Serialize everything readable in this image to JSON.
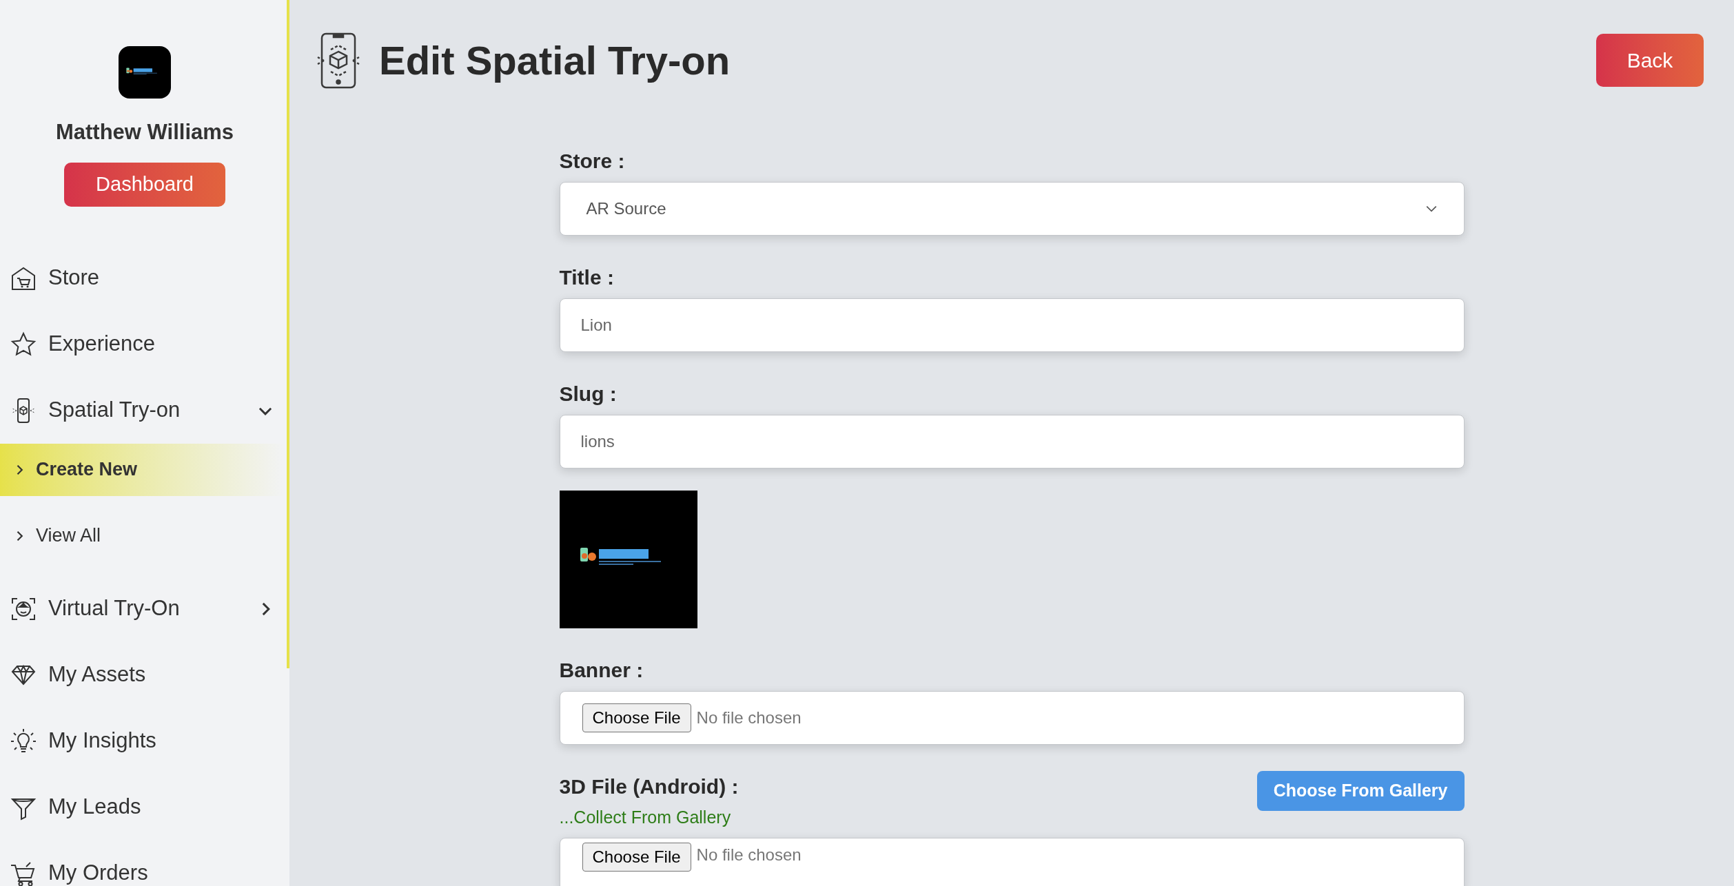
{
  "sidebar": {
    "user_name": "Matthew Williams",
    "dashboard_button": "Dashboard",
    "items": [
      {
        "label": "Store",
        "selected": false
      },
      {
        "label": "Experience",
        "selected": false
      },
      {
        "label": "Spatial Try-on",
        "selected": false,
        "expanded": true,
        "children": [
          {
            "label": "Create New",
            "selected": true
          },
          {
            "label": "View All",
            "selected": false
          }
        ]
      },
      {
        "label": "Virtual Try-On",
        "selected": false,
        "expanded": false
      },
      {
        "label": "My Assets",
        "selected": false
      },
      {
        "label": "My Insights",
        "selected": false
      },
      {
        "label": "My Leads",
        "selected": false
      },
      {
        "label": "My Orders",
        "selected": false
      }
    ]
  },
  "header": {
    "title": "Edit Spatial Try-on",
    "back_button": "Back"
  },
  "form": {
    "fields": [
      {
        "kind": "select",
        "label": "Store :",
        "value": "AR Source"
      },
      {
        "kind": "text",
        "label": "Title :",
        "value": "Lion"
      },
      {
        "kind": "text",
        "label": "Slug :",
        "value": "lions"
      },
      {
        "kind": "picture"
      },
      {
        "kind": "file",
        "label": "Banner :",
        "button": "Choose File",
        "status": "No file chosen"
      },
      {
        "kind": "file",
        "label": "3D File (Android) :",
        "note": "...Collect From Gallery",
        "gallery_button": "Choose From Gallery",
        "button": "Choose File",
        "status": "No file chosen"
      }
    ]
  }
}
